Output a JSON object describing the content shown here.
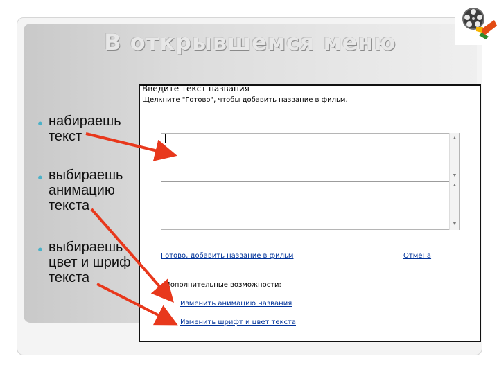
{
  "slide": {
    "title": "В открывшемся меню",
    "bullets": [
      {
        "line1": "набираешь",
        "line2": "текст",
        "line3": ""
      },
      {
        "line1": "выбираешь",
        "line2": "анимацию",
        "line3": "текста"
      },
      {
        "line1": "выбираешь",
        "line2": "цвет и шриф",
        "line3": "текста"
      }
    ]
  },
  "dialog": {
    "title": "Введите текст названия",
    "subtitle": "Щелкните \"Готово\", чтобы добавить название в фильм.",
    "done_link": "Готово, добавить название в фильм",
    "cancel_link": "Отмена",
    "more_options_label": "Дополнительные возможности:",
    "change_animation_link": "Изменить анимацию названия",
    "change_font_link": "Изменить шрифт и цвет текста"
  },
  "colors": {
    "arrow": "#e8381c",
    "bullet": "#4bb1c8",
    "link": "#00339a"
  },
  "icons": {
    "logo": "movie-maker-logo-icon",
    "scroll_up": "scroll-up-icon",
    "scroll_down": "scroll-down-icon"
  }
}
